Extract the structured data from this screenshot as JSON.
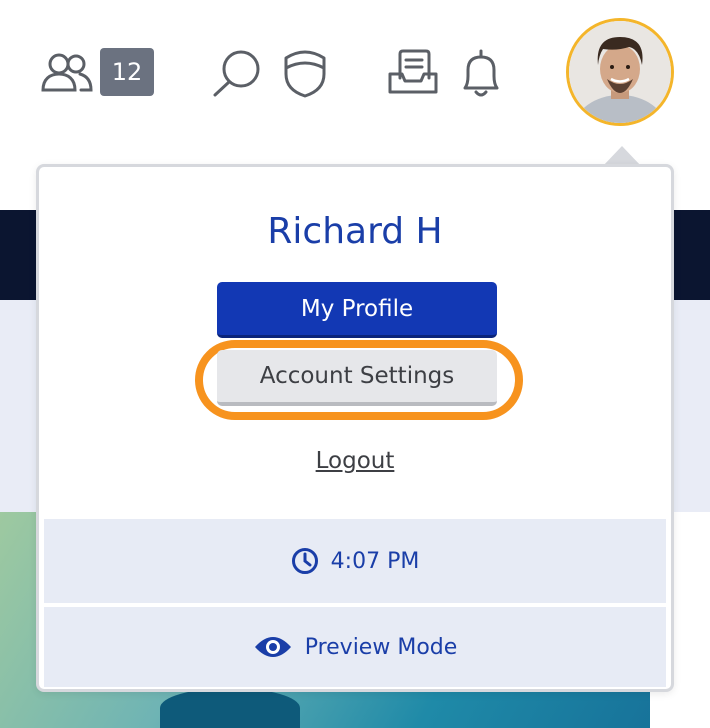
{
  "header": {
    "team_count": "12",
    "icons": [
      "users-icon",
      "search-icon",
      "shield-icon",
      "inbox-icon",
      "bell-icon",
      "avatar"
    ]
  },
  "menu": {
    "user_name": "Richard H",
    "my_profile_label": "My Profile",
    "account_settings_label": "Account Settings",
    "logout_label": "Logout",
    "time": "4:07 PM",
    "preview_mode_label": "Preview Mode"
  },
  "colors": {
    "primary_blue": "#1238b4",
    "highlight_orange": "#f7931e",
    "avatar_ring": "#f4b52a",
    "badge_gray": "#6b7280",
    "navy_band": "#0b1530"
  }
}
